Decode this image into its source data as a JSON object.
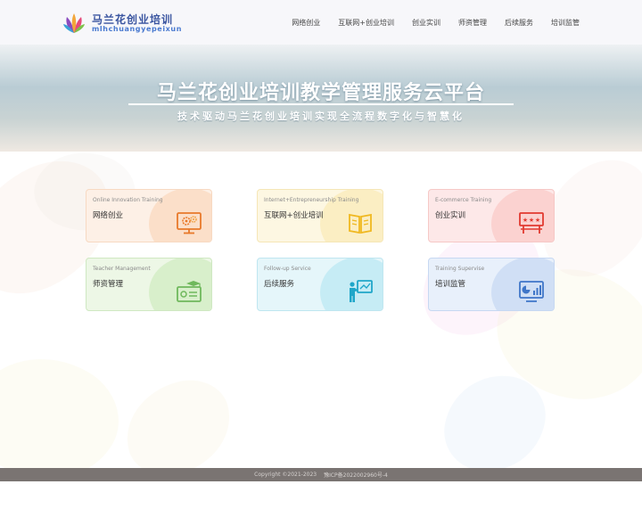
{
  "brand": {
    "name_cn": "马兰花创业培训",
    "name_en": "mlhchuangyepeixun"
  },
  "nav": [
    {
      "label": "网络创业"
    },
    {
      "label": "互联网+创业培训"
    },
    {
      "label": "创业实训"
    },
    {
      "label": "师资管理"
    },
    {
      "label": "后续服务"
    },
    {
      "label": "培训监管"
    }
  ],
  "hero": {
    "title": "马兰花创业培训教学管理服务云平台",
    "subtitle": "技术驱动马兰花创业培训实现全流程数字化与智慧化"
  },
  "cards": [
    {
      "en": "Online Innovation Training",
      "cn": "网络创业",
      "icon": "computer-gears-icon",
      "accent": "#f0883a"
    },
    {
      "en": "Internet+Entrepreneurship Training",
      "cn": "互联网+创业培训",
      "icon": "book-icon",
      "accent": "#f5c22e"
    },
    {
      "en": "E-commerce Training",
      "cn": "创业实训",
      "icon": "rating-board-icon",
      "accent": "#e8453c"
    },
    {
      "en": "Teacher Management",
      "cn": "师资管理",
      "icon": "graduation-certificate-icon",
      "accent": "#79bf6a"
    },
    {
      "en": "Follow-up Service",
      "cn": "后续服务",
      "icon": "presenter-board-icon",
      "accent": "#2eaecf"
    },
    {
      "en": "Training Supervise",
      "cn": "培训监管",
      "icon": "analytics-monitor-icon",
      "accent": "#4a7fd0"
    }
  ],
  "footer": {
    "copyright": "Copyright ©2021-2023",
    "icp": "豫ICP备2022002960号-4"
  }
}
